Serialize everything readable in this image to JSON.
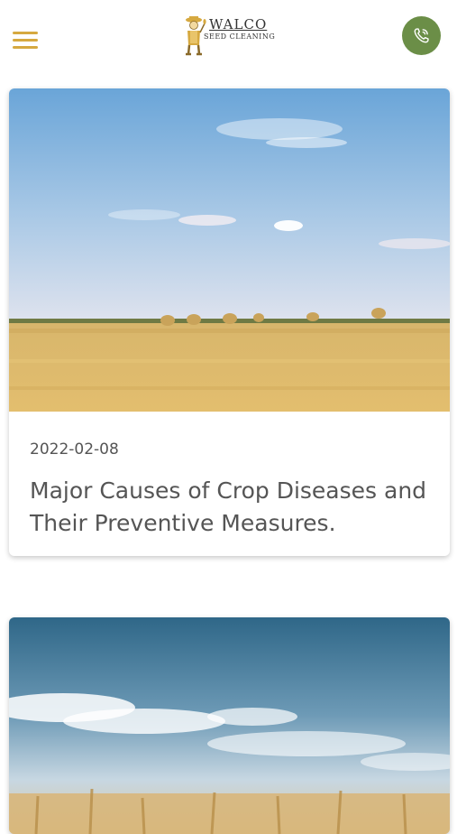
{
  "header": {
    "menu_icon": "hamburger-menu-icon",
    "logo": {
      "line1": "WALCO",
      "line2": "SEED CLEANING"
    },
    "phone_icon": "phone-call-icon",
    "colors": {
      "menu": "#d6a940",
      "phone_bg": "#6b8e47"
    }
  },
  "articles": [
    {
      "date": "2022-02-08",
      "title": "Major Causes of Crop Diseases and Their Preventive Measures.",
      "image": "wheat-field-hay-bales-photo"
    },
    {
      "date": "",
      "title": "",
      "image": "wheat-field-cloudy-sky-photo"
    }
  ]
}
